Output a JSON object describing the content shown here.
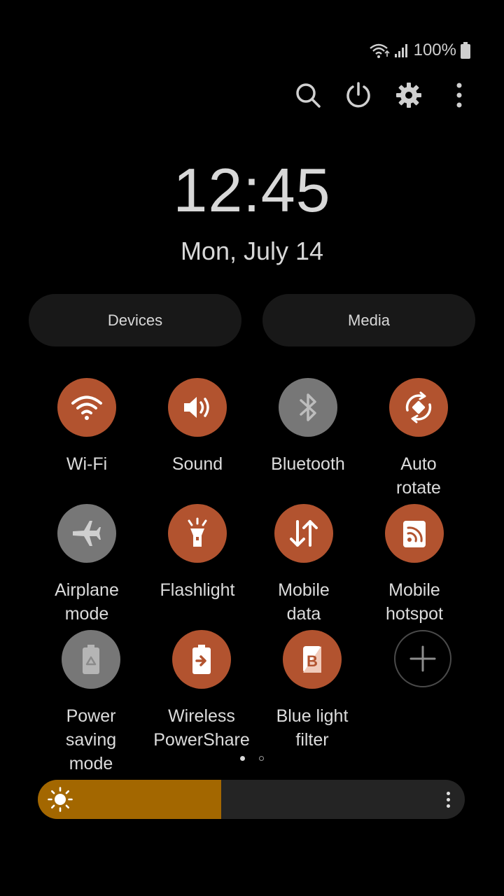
{
  "status_bar": {
    "battery_text": "100%",
    "icons": [
      "wifi-icon",
      "signal-icon",
      "battery-icon"
    ]
  },
  "top_actions": [
    "search-icon",
    "power-icon",
    "settings-icon",
    "more-options-icon"
  ],
  "clock": {
    "time": "12:45",
    "date": "Mon, July 14"
  },
  "pills": {
    "devices": "Devices",
    "media": "Media"
  },
  "tiles": [
    {
      "label": "Wi-Fi",
      "icon": "wifi-icon",
      "state": "on"
    },
    {
      "label": "Sound",
      "icon": "sound-icon",
      "state": "on"
    },
    {
      "label": "Bluetooth",
      "icon": "bluetooth-icon",
      "state": "off"
    },
    {
      "label": "Auto\nrotate",
      "icon": "auto-rotate-icon",
      "state": "on"
    },
    {
      "label": "Airplane\nmode",
      "icon": "airplane-icon",
      "state": "off"
    },
    {
      "label": "Flashlight",
      "icon": "flashlight-icon",
      "state": "on"
    },
    {
      "label": "Mobile\ndata",
      "icon": "mobile-data-icon",
      "state": "on"
    },
    {
      "label": "Mobile\nhotspot",
      "icon": "hotspot-icon",
      "state": "on"
    },
    {
      "label": "Power saving\nmode",
      "icon": "power-saving-icon",
      "state": "off"
    },
    {
      "label": "Wireless\nPowerShare",
      "icon": "wireless-powershare-icon",
      "state": "on"
    },
    {
      "label": "Blue light\nfilter",
      "icon": "blue-light-filter-icon",
      "state": "on"
    },
    {
      "label": "",
      "icon": "add-icon",
      "state": "add"
    }
  ],
  "pagination": {
    "pages": 2,
    "current": 1
  },
  "brightness": {
    "level": 0.43,
    "icon": "sun-icon"
  },
  "colors": {
    "accent_on": "#b2532f",
    "tile_off": "#777777",
    "brightness_fill": "#a36700",
    "background": "#000000"
  }
}
